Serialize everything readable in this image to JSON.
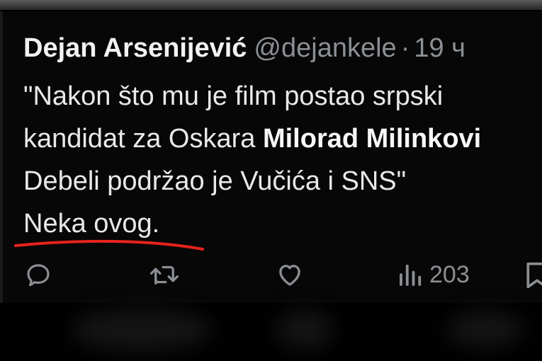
{
  "tweet": {
    "author_name": "Dejan Arsenijević",
    "handle": "@dejankele",
    "separator": "·",
    "time": "19 ч",
    "text_line1": "\"Nakon što mu je film postao srpski",
    "text_line2_prefix": "kandidat za Oskara ",
    "text_line2_bold": "Milorad Milinkovi",
    "text_line3": "Debeli podržao je Vučića i SNS\"",
    "text_line4": "Neka ovog."
  },
  "actions": {
    "views": "203"
  },
  "colors": {
    "background": "#000000",
    "text": "#e7e9ea",
    "muted": "#8b8f94",
    "underline_mark": "#e8231c"
  },
  "icons": [
    "reply-icon",
    "retweet-icon",
    "like-icon",
    "views-icon",
    "bookmark-icon"
  ]
}
